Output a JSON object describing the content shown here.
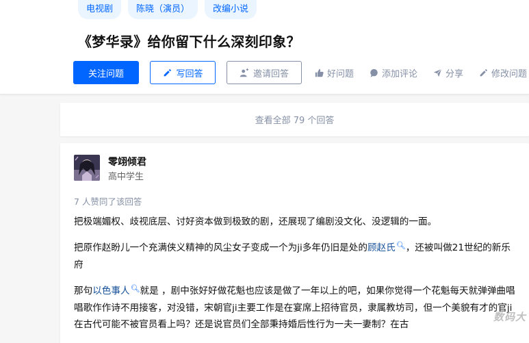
{
  "topics": [
    "电视剧",
    "陈晓（演员）",
    "改编小说"
  ],
  "question": {
    "title": "《梦华录》给你留下什么深刻印象？"
  },
  "actions": {
    "follow": "关注问题",
    "write": "写回答",
    "invite": "邀请回答",
    "good": "好问题",
    "comment": "添加评论",
    "share": "分享",
    "edit": "修改问题"
  },
  "view_all": "查看全部 79 个回答",
  "answer": {
    "author_name": "零翊倾君",
    "author_badge": "高中学生",
    "votes": "7 人赞同了该回答",
    "p1": "把极端媚权、歧视底层、讨好资本做到极致的剧，还展现了编剧没文化、没逻辑的一面。",
    "p2_a": "把原作赵盼儿一个充满侠义精神的风尘女子变成一个为ji多年仍旧是处的",
    "p2_link": "顾赵氏",
    "p2_b": "，还被叫做21世纪的新乐府",
    "p3_a": "那句",
    "p3_link": "以色事人",
    "p3_b": "就是 ，剧中张好好做花魁也应该是做了一年以上的吧，如果你觉得一个花魁每天就弹弹曲唱唱歌作作诗不用接客，对没错，宋朝官ji主要工作是在宴席上招待官员，隶属教坊司，但一个美貌有才的官ji在古代可能不被官员看上吗？还是说官员们全部秉持婚后性行为一夫一妻制？在古"
  },
  "watermark": "数码大",
  "colors": {
    "primary": "#0066ff",
    "muted": "#8590a6",
    "link": "#175199",
    "background": "#f6f6f6"
  }
}
